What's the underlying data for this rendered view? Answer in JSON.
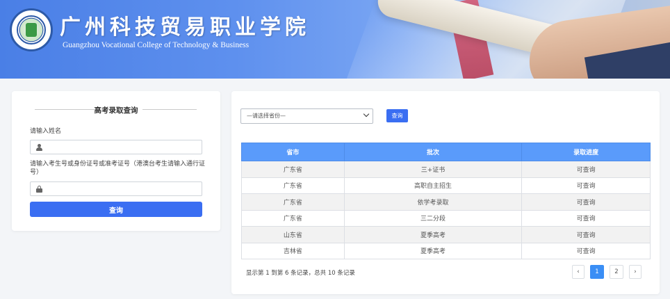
{
  "header": {
    "school_name_cn": "广州科技贸易职业学院",
    "school_name_en": "Guangzhou Vocational College of Technology & Business"
  },
  "login": {
    "title": "高考录取查询",
    "name_label": "请输入姓名",
    "name_value": "",
    "id_label": "请输入考生号或身份证号或准考证号（港澳台考生请输入通行证号）",
    "id_value": "",
    "submit_label": "查询"
  },
  "search": {
    "province_placeholder": "—请选择省份—",
    "query_label": "查询"
  },
  "table": {
    "columns": [
      "省市",
      "批次",
      "录取进度"
    ],
    "rows": [
      [
        "广东省",
        "三+证书",
        "可查询"
      ],
      [
        "广东省",
        "高职自主招生",
        "可查询"
      ],
      [
        "广东省",
        "依学考录取",
        "可查询"
      ],
      [
        "广东省",
        "三二分段",
        "可查询"
      ],
      [
        "山东省",
        "夏季高考",
        "可查询"
      ],
      [
        "吉林省",
        "夏季高考",
        "可查询"
      ]
    ]
  },
  "pagination": {
    "summary": "显示第 1 到第 6 条记录，总共 10 条记录",
    "prev": "‹",
    "pages": [
      "1",
      "2"
    ],
    "next": "›",
    "active_page": "1"
  },
  "colors": {
    "accent": "#3a6ef2",
    "table_header": "#5a9bfb",
    "banner": "#4a7fe6"
  }
}
